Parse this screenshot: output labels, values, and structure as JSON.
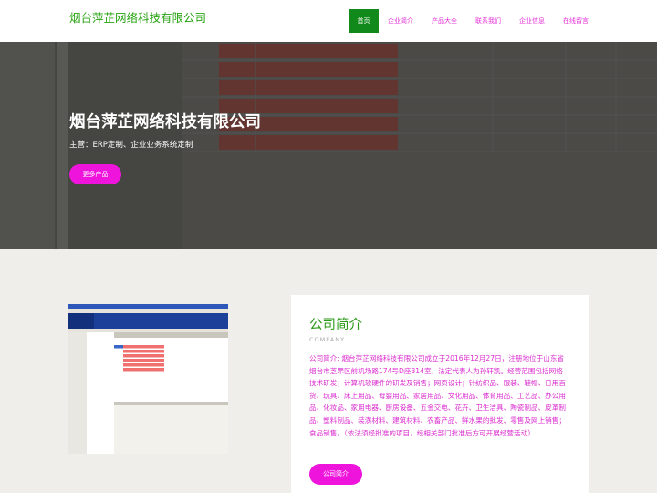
{
  "brand": {
    "name": "烟台萍芷网络科技有限公司"
  },
  "nav": {
    "items": [
      {
        "label": "首页",
        "active": true
      },
      {
        "label": "企业简介",
        "active": false
      },
      {
        "label": "产品大全",
        "active": false
      },
      {
        "label": "联系我们",
        "active": false
      },
      {
        "label": "企业信息",
        "active": false
      },
      {
        "label": "在线留言",
        "active": false
      }
    ]
  },
  "hero": {
    "title": "烟台萍芷网络科技有限公司",
    "subtitle": "主营：ERP定制、企业业务系统定制",
    "button_label": "更多产品"
  },
  "about": {
    "title": "公司简介",
    "eyebrow": "COMPANY",
    "body": "公司简介: 烟台萍芷网络科技有限公司成立于2016年12月27日，注册地位于山东省烟台市芝罘区前机场路174号D座314室，法定代表人为孙轩凯。经营范围包括网络技术研发；计算机软硬件的研发及销售；网页设计；针纺织品、服装、鞋帽、日用百货、玩具、床上用品、母婴用品、家居用品、文化用品、体育用品、工艺品、办公用品、化妆品、家用电器、厨房设备、五金交电、花卉、卫生洁具、陶瓷制品、皮革制品、塑料制品、装潢材料、建筑材料、农畜产品、鲜水果的批发、零售及网上销售；食品销售。（依法须经批准的项目，经相关部门批准后方可开展经营活动）",
    "button_label": "公司简介"
  },
  "colors": {
    "brand_green": "#27a312",
    "nav_active": "#12891b",
    "accent_pink": "#ee14dc"
  }
}
